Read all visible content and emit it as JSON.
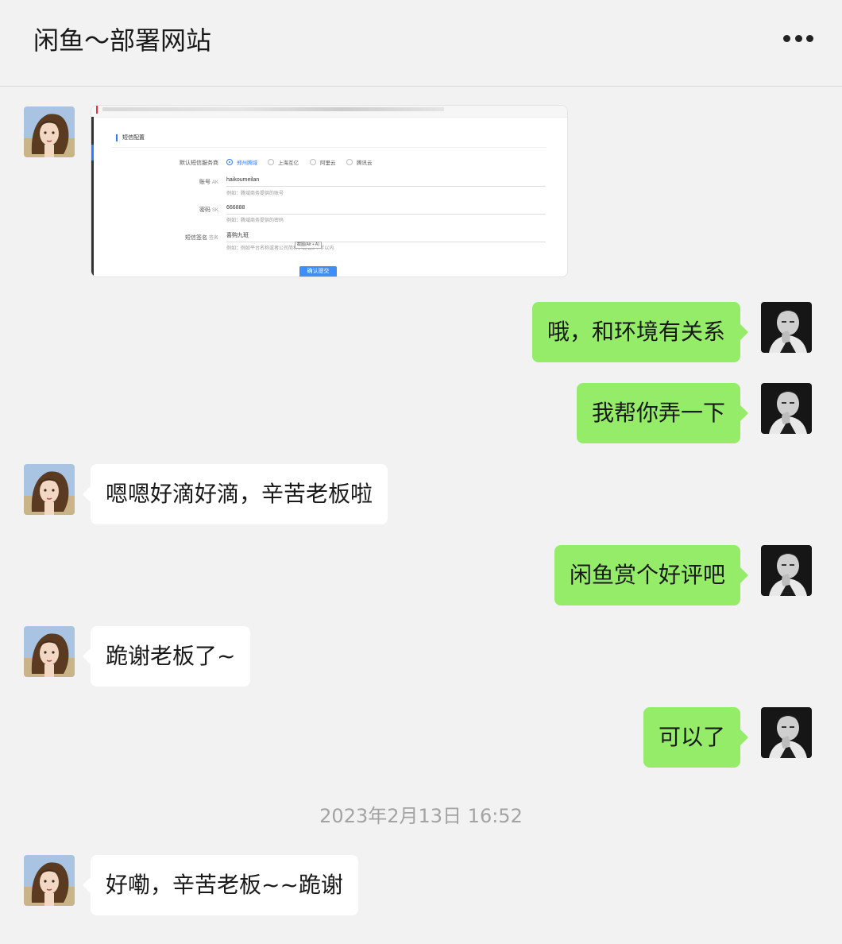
{
  "header": {
    "title": "闲鱼～部署网站",
    "more_icon": "more-dots-icon"
  },
  "screenshot": {
    "section_title": "短信配置",
    "provider_label": "默认短信服务商",
    "providers": [
      "郑州腾域",
      "上海互亿",
      "阿里云",
      "腾讯云"
    ],
    "selected_provider": "郑州腾域",
    "account_label": "账号",
    "account_suffix": "AK",
    "account_value": "haikoumeilan",
    "account_hint": "例如：腾域商务提供的账号",
    "password_label": "密码",
    "password_suffix": "SK",
    "password_value": "666888",
    "password_hint": "例如：腾域商务提供的密码",
    "sign_label": "短信签名",
    "sign_suffix": "签名",
    "sign_value": "喜购九班",
    "sign_hint": "例如：例如平台名称或者公司简称，建议5个字以内",
    "tooltip": "截图(Alt + A)",
    "submit_label": "确认提交"
  },
  "messages": [
    {
      "side": "right",
      "text": "哦，和环境有关系"
    },
    {
      "side": "right",
      "text": "我帮你弄一下"
    },
    {
      "side": "left",
      "text": "嗯嗯好滴好滴，辛苦老板啦"
    },
    {
      "side": "right",
      "text": "闲鱼赏个好评吧"
    },
    {
      "side": "left",
      "text": "跪谢老板了~"
    },
    {
      "side": "right",
      "text": "可以了"
    },
    {
      "side": "left",
      "text": "好嘞，辛苦老板~~跪谢"
    }
  ],
  "timestamp": "2023年2月13日 16:52",
  "colors": {
    "bubble_green": "#95ec69",
    "bubble_white": "#ffffff",
    "background": "#f2f2f2"
  }
}
